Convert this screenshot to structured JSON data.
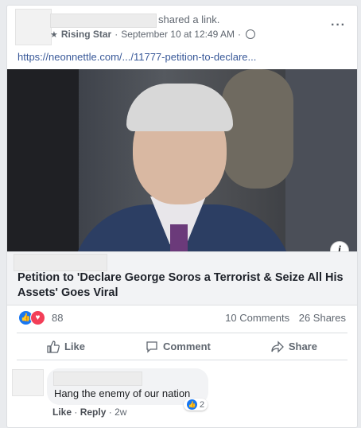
{
  "post": {
    "shared_text": "shared a link.",
    "author": "Rising Star",
    "timestamp": "September 10 at 12:49 AM",
    "separator": "·",
    "more": "···",
    "link_url": "https://neonnettle.com/.../11777-petition-to-declare..."
  },
  "link_preview": {
    "title": "Petition to 'Declare George Soros a Terrorist & Seize All His Assets' Goes Viral",
    "info_icon": "i"
  },
  "stats": {
    "reaction_count": "88",
    "comments": "10 Comments",
    "shares": "26 Shares"
  },
  "actions": {
    "like": "Like",
    "comment": "Comment",
    "share": "Share"
  },
  "comment": {
    "text": "Hang the enemy of our nation",
    "reaction_count": "2",
    "like": "Like",
    "reply": "Reply",
    "age": "2w"
  },
  "icons": {
    "globe": "globe-icon",
    "star": "star-icon",
    "like_reaction": "like-reaction-icon",
    "love_reaction": "love-reaction-icon"
  },
  "colors": {
    "link": "#385898",
    "like_blue": "#1877f2",
    "love_red": "#f33e58"
  }
}
